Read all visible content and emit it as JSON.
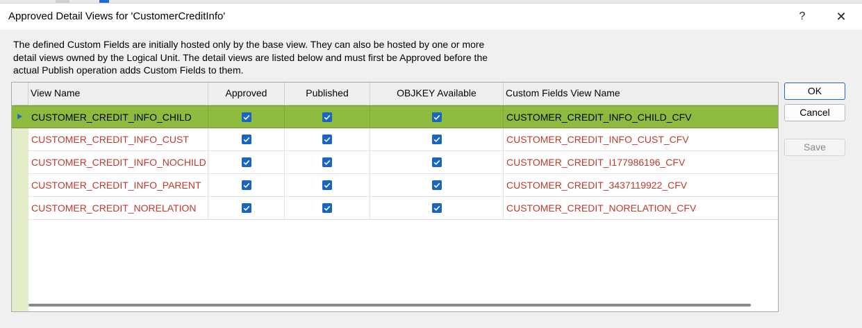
{
  "dialog": {
    "title": "Approved Detail Views for 'CustomerCreditInfo'",
    "help_label": "?",
    "close_label": "✕",
    "description": "The defined Custom Fields are initially hosted only by the base view. They can also be hosted by one or more detail views owned by the Logical Unit. The detail views are listed below and must first be Approved before the actual Publish operation adds Custom Fields to them."
  },
  "grid": {
    "columns": [
      "View Name",
      "Approved",
      "Published",
      "OBJKEY Available",
      "Custom Fields View Name"
    ],
    "rows": [
      {
        "view_name": "CUSTOMER_CREDIT_INFO_CHILD",
        "approved": true,
        "published": true,
        "objkey_available": true,
        "cf_view_name": "CUSTOMER_CREDIT_INFO_CHILD_CFV",
        "selected": true
      },
      {
        "view_name": "CUSTOMER_CREDIT_INFO_CUST",
        "approved": true,
        "published": true,
        "objkey_available": true,
        "cf_view_name": "CUSTOMER_CREDIT_INFO_CUST_CFV",
        "selected": false
      },
      {
        "view_name": "CUSTOMER_CREDIT_INFO_NOCHILD",
        "approved": true,
        "published": true,
        "objkey_available": true,
        "cf_view_name": "CUSTOMER_CREDIT_I177986196_CFV",
        "selected": false
      },
      {
        "view_name": "CUSTOMER_CREDIT_INFO_PARENT",
        "approved": true,
        "published": true,
        "objkey_available": true,
        "cf_view_name": "CUSTOMER_CREDIT_3437119922_CFV",
        "selected": false
      },
      {
        "view_name": "CUSTOMER_CREDIT_NORELATION",
        "approved": true,
        "published": true,
        "objkey_available": true,
        "cf_view_name": "CUSTOMER_CREDIT_NORELATION_CFV",
        "selected": false
      }
    ]
  },
  "buttons": {
    "ok": "OK",
    "cancel": "Cancel",
    "save": "Save"
  },
  "colors": {
    "selected_row": "#8dbb3f",
    "row_header": "#e3edca",
    "unselected_text": "#c0392b",
    "checkbox": "#1a64c2"
  }
}
